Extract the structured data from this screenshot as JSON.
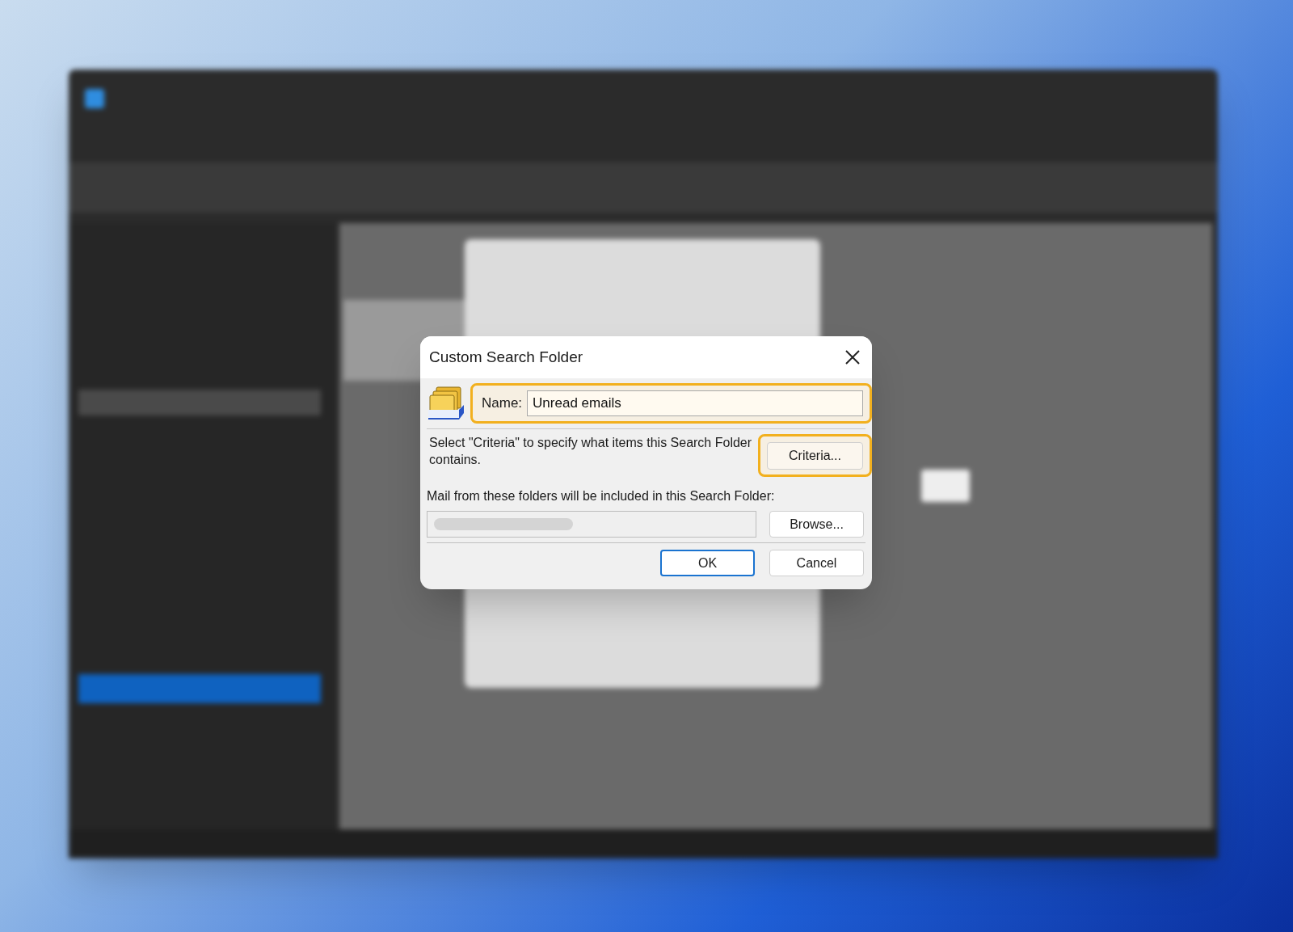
{
  "dialog": {
    "title": "Custom Search Folder",
    "name_field": {
      "label": "Name:",
      "value": "Unread emails",
      "highlighted": true
    },
    "description": "Select \"Criteria\" to specify what items this Search Folder contains.",
    "criteria_button": {
      "label": "Criteria...",
      "highlighted": true
    },
    "folders_label": "Mail from these folders will be included in this Search Folder:",
    "browse_button": {
      "label": "Browse...",
      "highlighted": false
    },
    "buttons": [
      {
        "label": "OK",
        "default": true
      },
      {
        "label": "Cancel",
        "default": false
      }
    ]
  }
}
